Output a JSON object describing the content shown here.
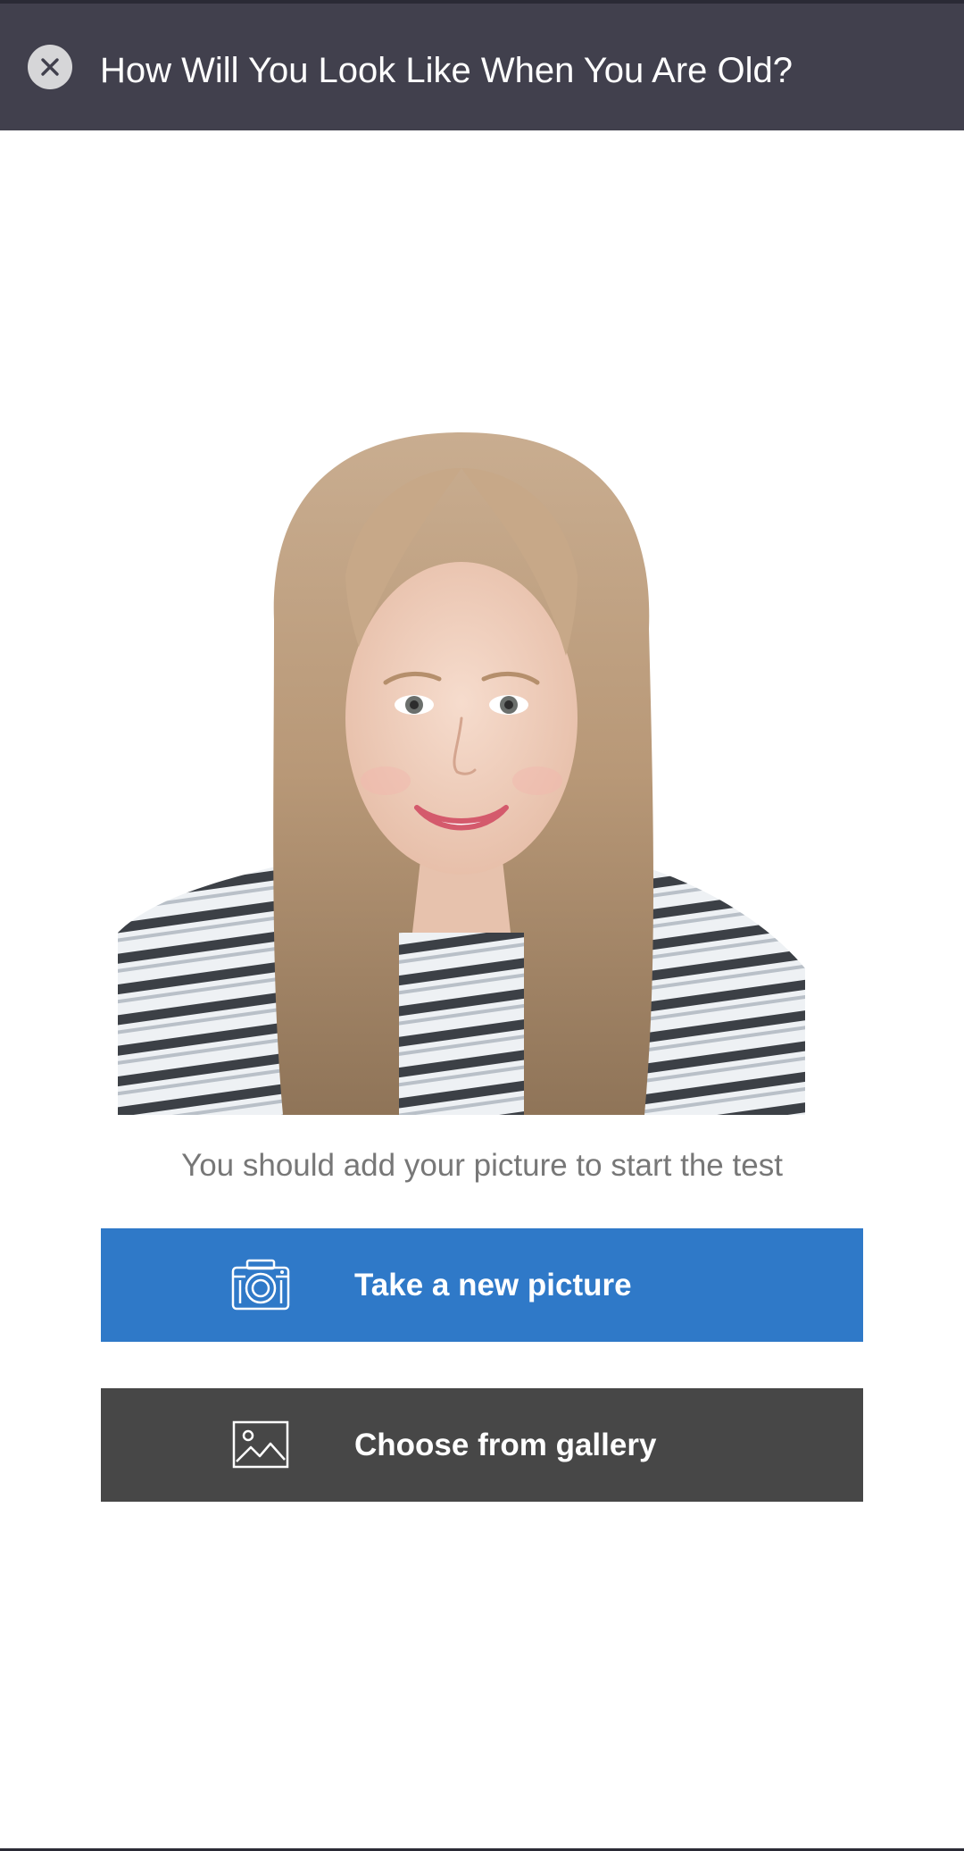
{
  "app_bar": {
    "title": "How Will You Look Like When You Are Old?",
    "close_icon": "close-icon"
  },
  "main": {
    "hint": "You should add your picture to start the test",
    "buttons": {
      "camera": {
        "label": "Take a new picture",
        "icon": "camera-icon",
        "color": "#2f79c8"
      },
      "gallery": {
        "label": "Choose from gallery",
        "icon": "image-icon",
        "color": "#474747"
      }
    }
  },
  "colors": {
    "app_bar": "#41404d",
    "hint_text": "#777777"
  }
}
